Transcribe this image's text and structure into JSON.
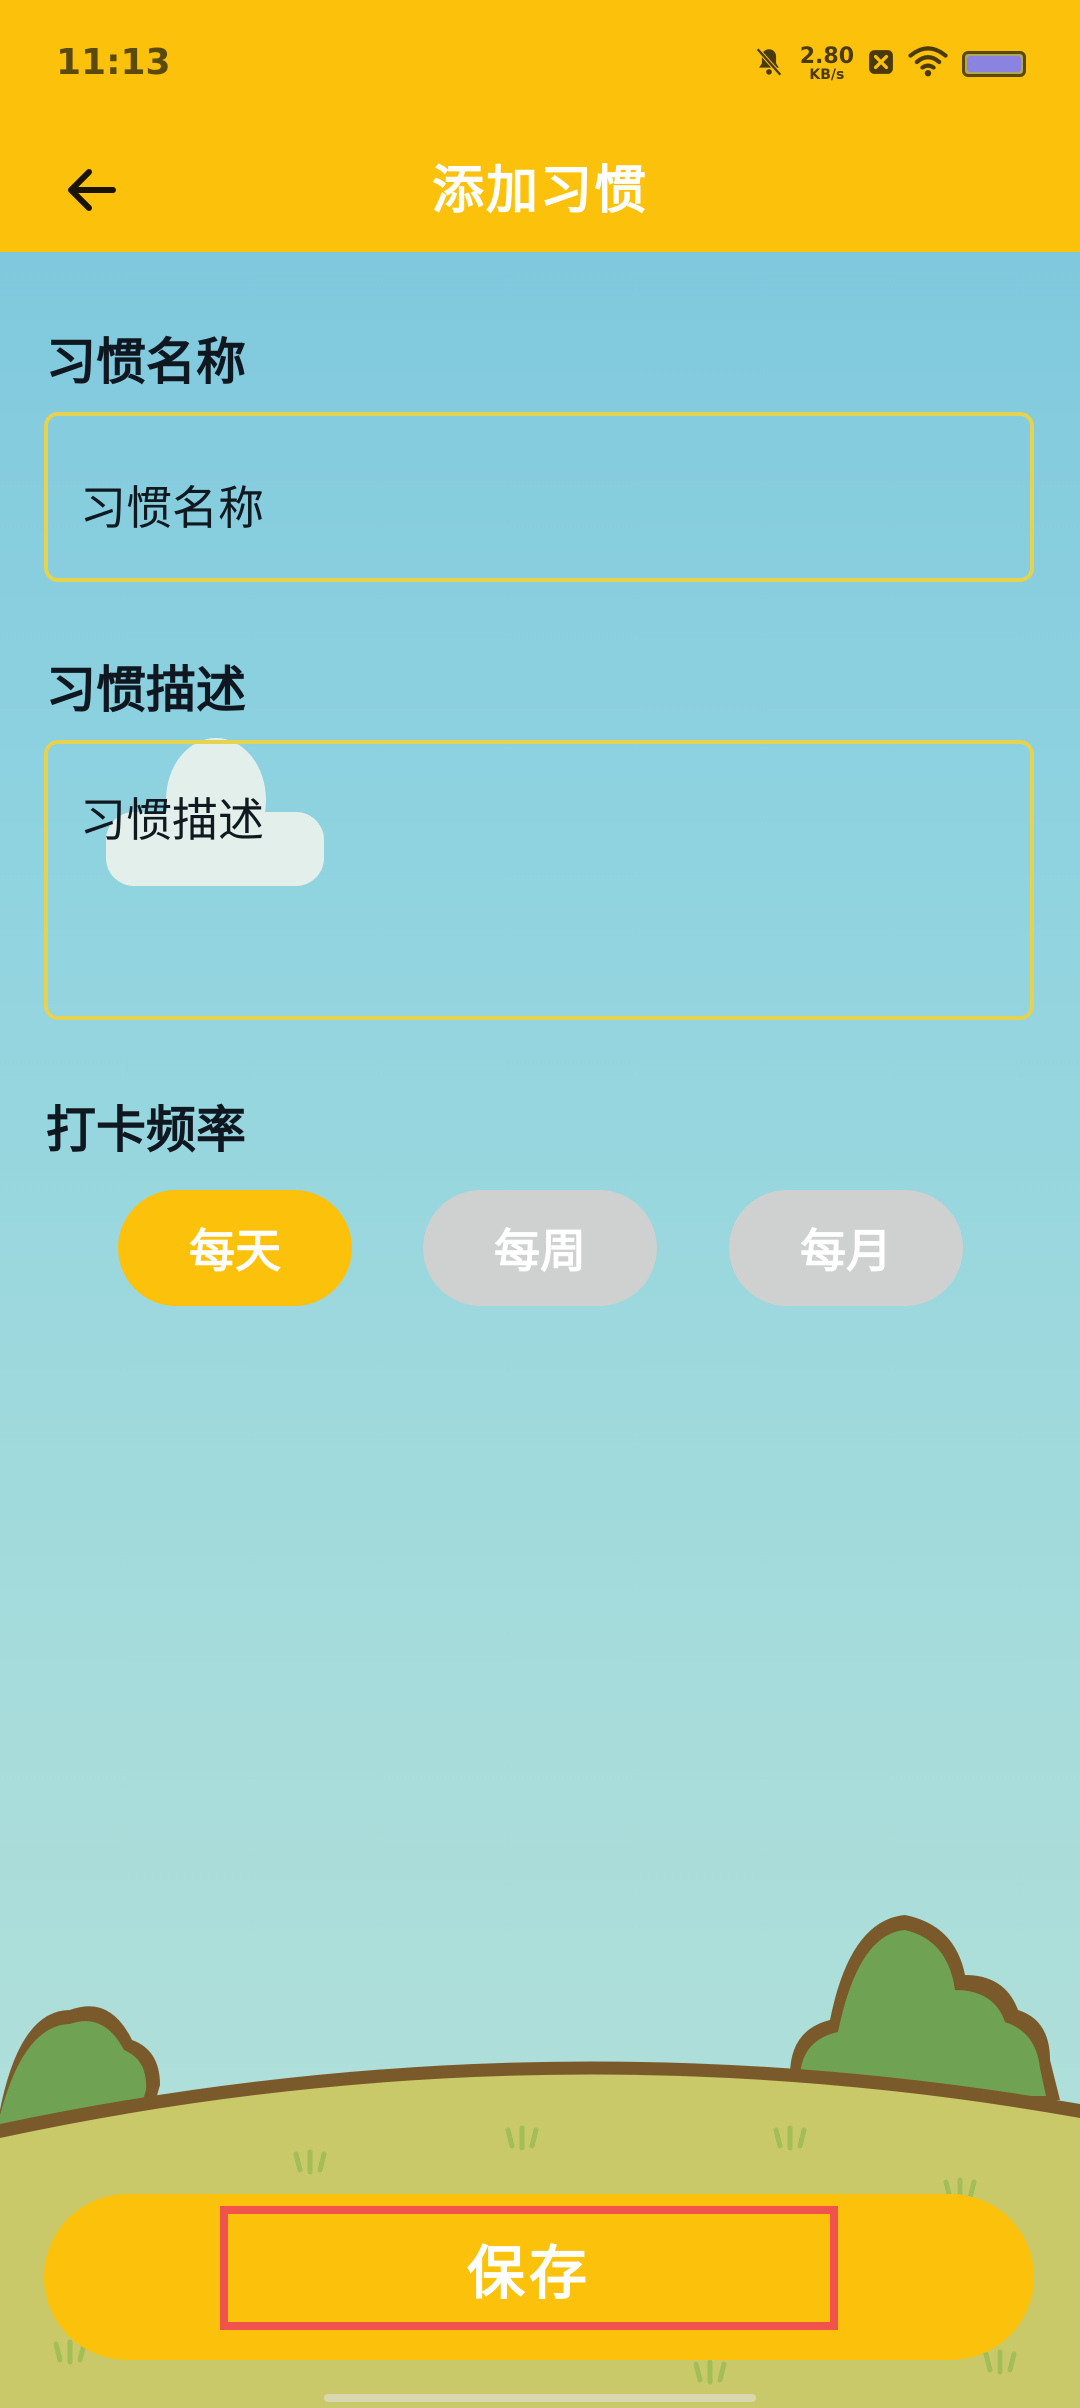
{
  "status_bar": {
    "time": "11:13",
    "speed_value": "2.80",
    "speed_unit": "KB/s",
    "battery_level": 0.95
  },
  "app_bar": {
    "title": "添加习惯"
  },
  "form": {
    "name_label": "习惯名称",
    "name_value": "习惯名称",
    "desc_label": "习惯描述",
    "desc_value": "习惯描述",
    "freq_label": "打卡频率",
    "freq_options": [
      "每天",
      "每周",
      "每月"
    ],
    "freq_selected": "每天"
  },
  "save_label": "保存",
  "colors": {
    "accent": "#fcc10a",
    "unselected": "#cfd0d0",
    "highlight": "#f0524c"
  }
}
